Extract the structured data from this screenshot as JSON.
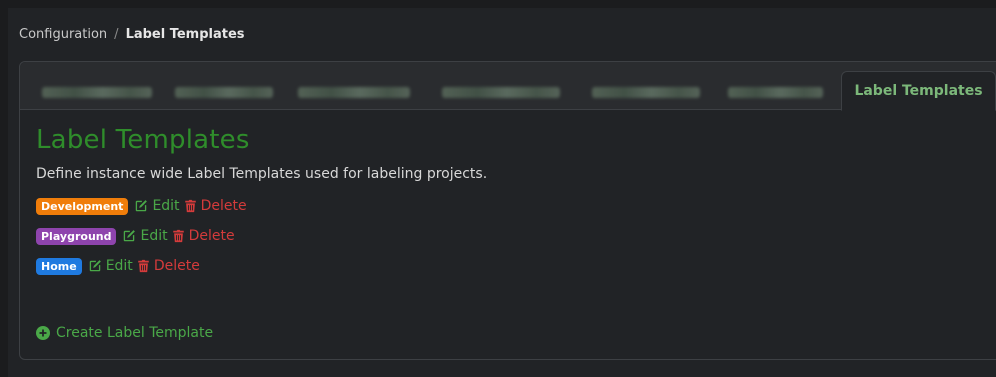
{
  "breadcrumb": {
    "root": "Configuration",
    "separator": "/",
    "current": "Label Templates"
  },
  "tabs": {
    "active_label": "Label Templates"
  },
  "main": {
    "title": "Label Templates",
    "description": "Define instance wide Label Templates used for labeling projects.",
    "templates": [
      {
        "name": "Development",
        "color": "#f07d0a",
        "edit_label": "Edit",
        "delete_label": "Delete"
      },
      {
        "name": "Playground",
        "color": "#8e44ad",
        "edit_label": "Edit",
        "delete_label": "Delete"
      },
      {
        "name": "Home",
        "color": "#1f7ae0",
        "edit_label": "Edit",
        "delete_label": "Delete"
      }
    ],
    "create_label": "Create Label Template"
  },
  "colors": {
    "accent_green": "#4aa848",
    "title_green": "#2f8d2b",
    "danger_red": "#d43b3b"
  },
  "icons": {
    "edit": "pencil-square-icon",
    "delete": "trash-icon",
    "create": "plus-circle-icon"
  }
}
